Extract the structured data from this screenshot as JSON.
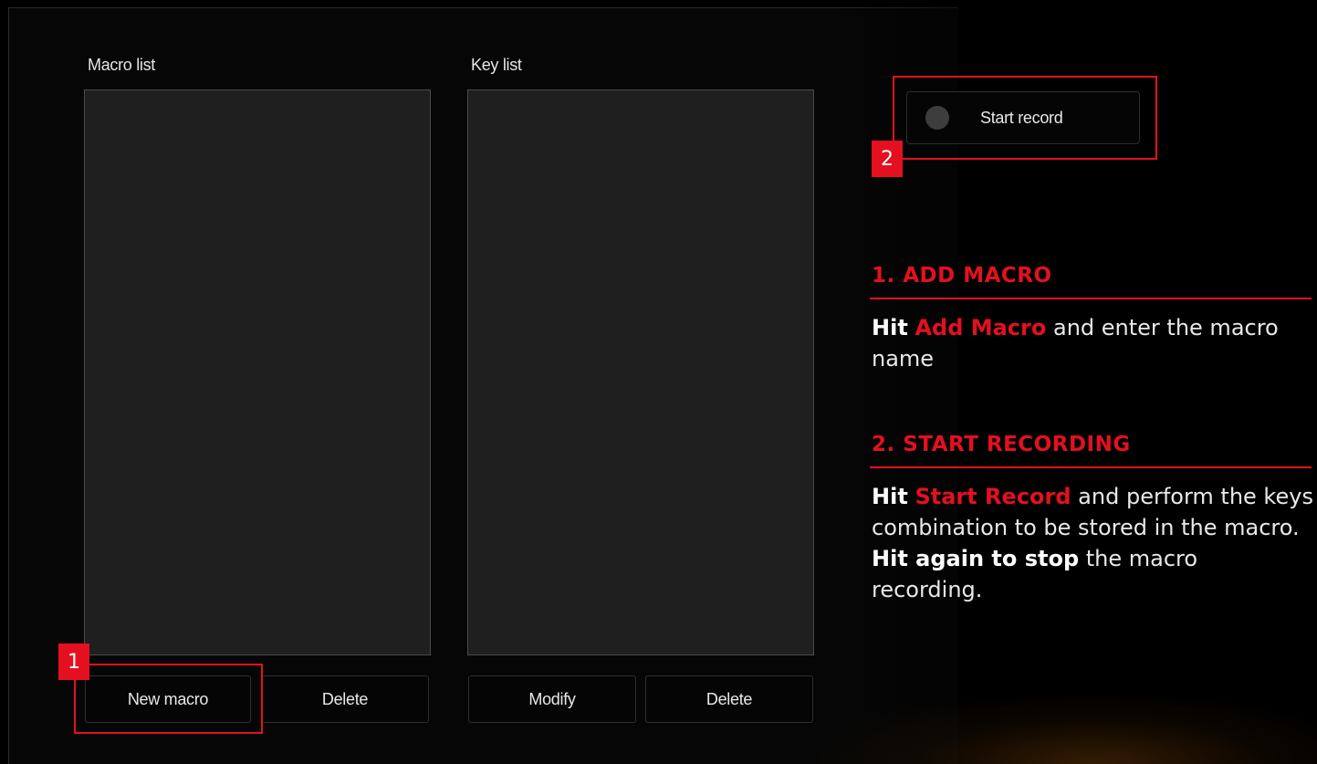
{
  "macro_panel": {
    "macro_list_label": "Macro list",
    "key_list_label": "Key list",
    "new_macro_button": "New macro",
    "macro_delete_button": "Delete",
    "modify_button": "Modify",
    "key_delete_button": "Delete",
    "start_record_button": "Start record"
  },
  "markers": {
    "one": "1",
    "two": "2"
  },
  "steps": {
    "step1": {
      "title": "1. ADD MACRO",
      "hit": "Hit",
      "accent": "Add Macro",
      "rest": " and enter the macro name"
    },
    "step2": {
      "title": "2. START RECORDING",
      "hit": "Hit",
      "accent": "Start Record",
      "rest1": " and perform the keys combination to be stored in the macro. ",
      "bold2": "Hit again to stop",
      "rest2": " the macro recording."
    }
  },
  "colors": {
    "accent": "#e4101f",
    "list_bg": "#1f1f1f",
    "background": "#000000"
  }
}
